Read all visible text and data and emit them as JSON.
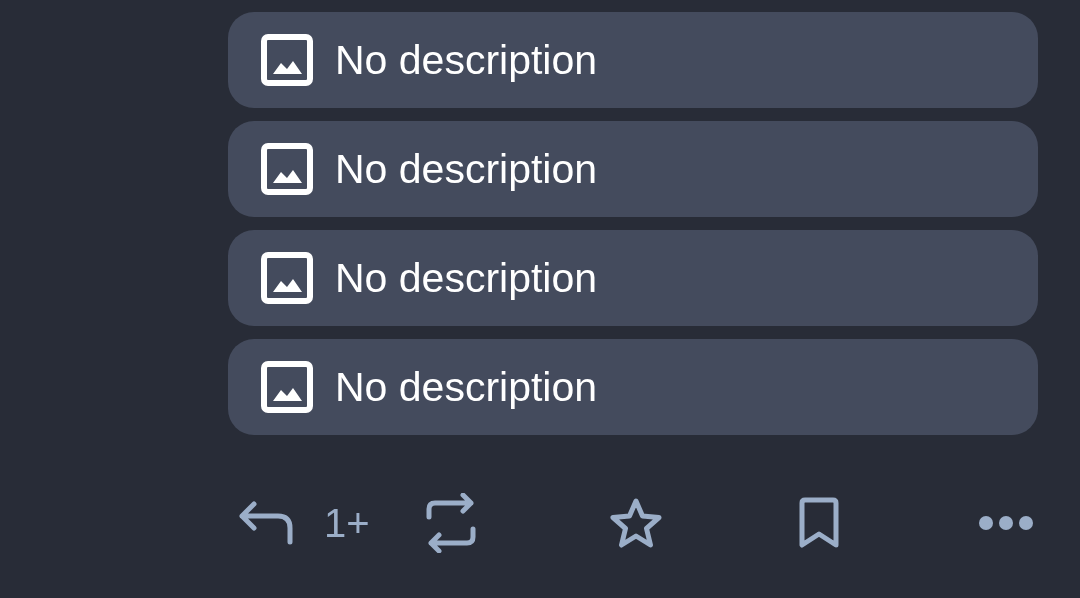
{
  "attachments": [
    {
      "description": "No description"
    },
    {
      "description": "No description"
    },
    {
      "description": "No description"
    },
    {
      "description": "No description"
    }
  ],
  "actions": [
    {
      "kind": "reply",
      "count": "1+"
    },
    {
      "kind": "boost"
    },
    {
      "kind": "favourite"
    },
    {
      "kind": "bookmark"
    },
    {
      "kind": "more"
    }
  ]
}
